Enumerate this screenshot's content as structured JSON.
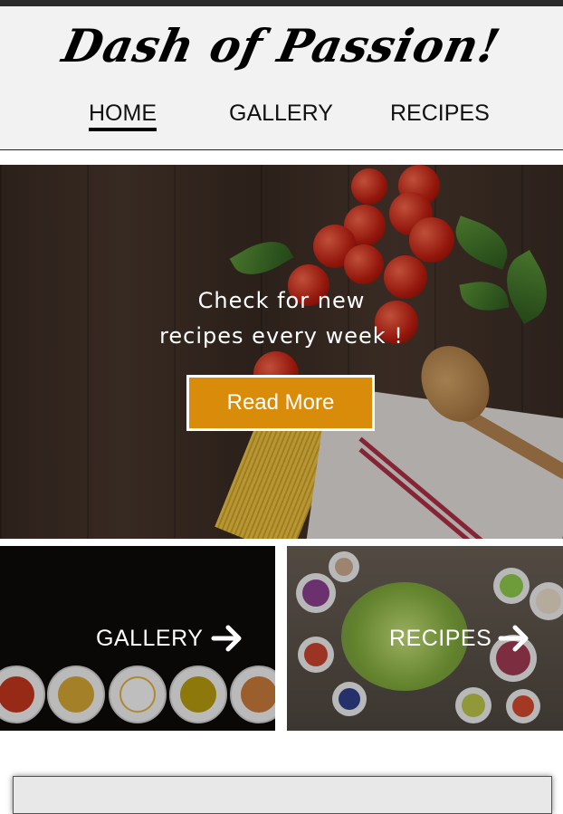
{
  "site": {
    "brand": "Dash of Passion!"
  },
  "nav": {
    "items": [
      {
        "label": "HOME",
        "active": true
      },
      {
        "label": "GALLERY",
        "active": false
      },
      {
        "label": "RECIPES",
        "active": false
      }
    ]
  },
  "hero": {
    "line1": "Check for new",
    "line2": "recipes every week !",
    "button_label": "Read More",
    "button_color": "#d98c0a"
  },
  "tiles": [
    {
      "label": "GALLERY",
      "icon": "arrow-right-icon"
    },
    {
      "label": "RECIPES",
      "icon": "arrow-right-icon"
    }
  ],
  "colors": {
    "topbar": "#2a2a2a",
    "header_bg": "#f2f2f2",
    "accent": "#d98c0a"
  }
}
